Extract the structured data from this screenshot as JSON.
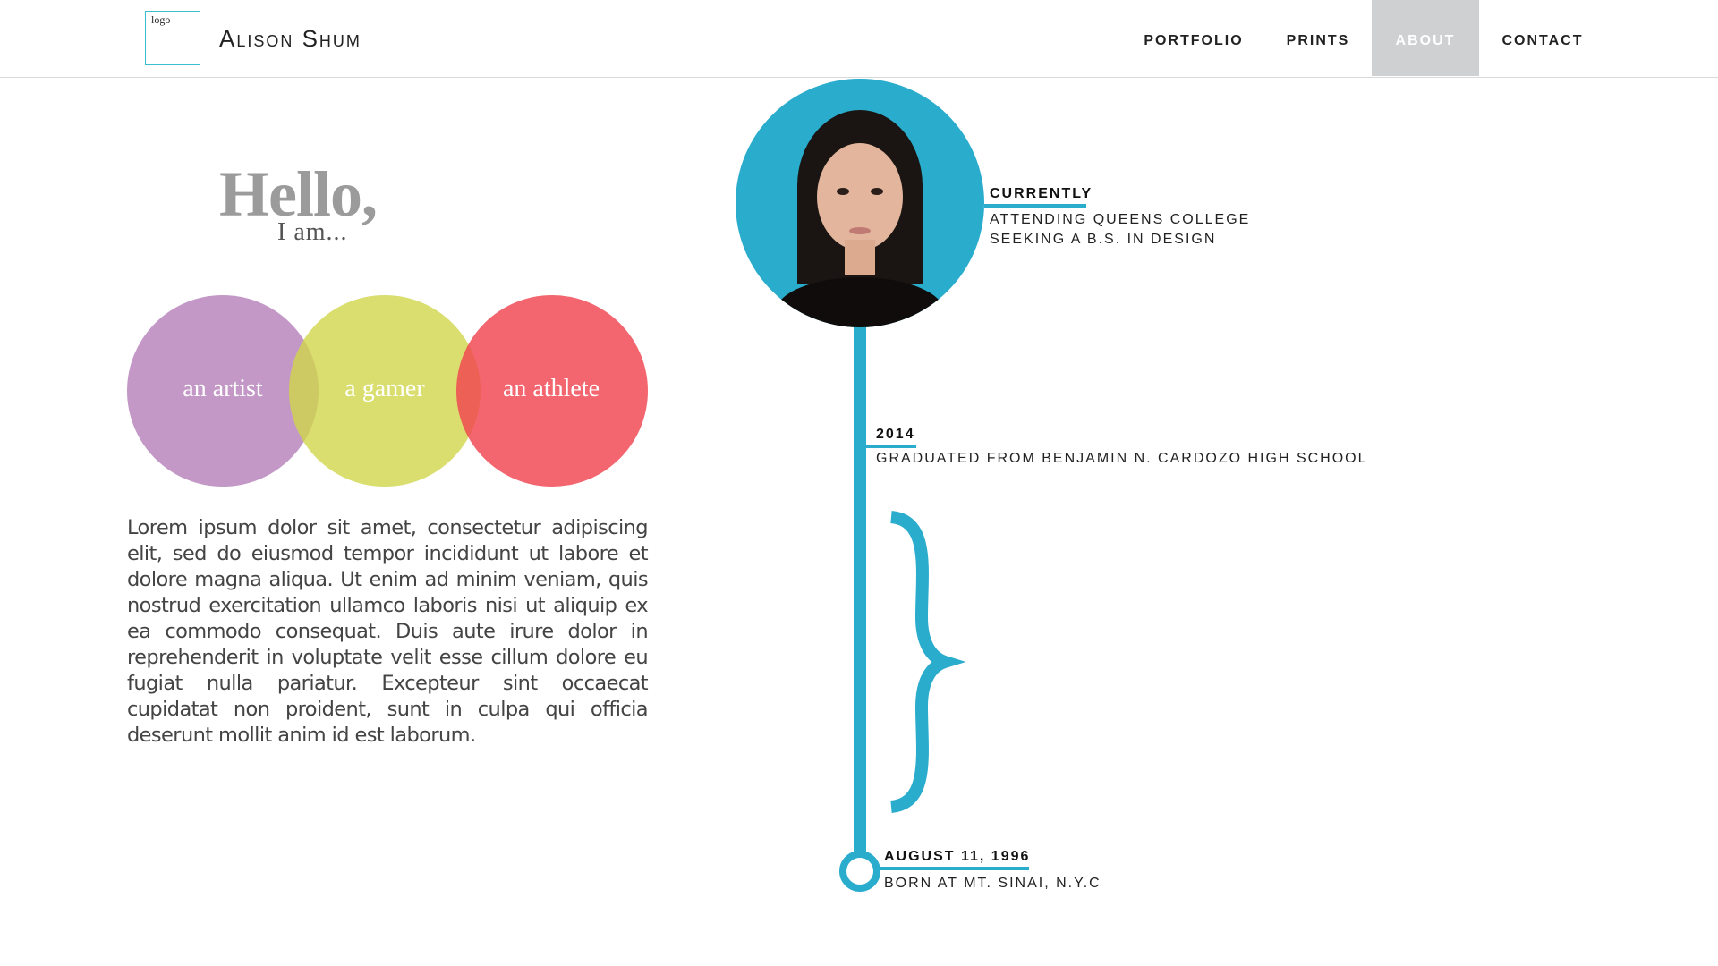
{
  "header": {
    "logo_text": "logo",
    "brand": "Alison Shum",
    "nav": {
      "portfolio": "PORTFOLIO",
      "prints": "PRINTS",
      "about": "ABOUT",
      "contact": "CONTACT"
    }
  },
  "intro": {
    "hello": "Hello,",
    "iam": "I am..."
  },
  "venn": {
    "items": [
      {
        "label": "an artist",
        "color": "#c39ac8"
      },
      {
        "label": "a gamer",
        "color": "#d8de6c"
      },
      {
        "label": "an athlete",
        "color": "#f2646e"
      }
    ]
  },
  "bio": "Lorem ipsum dolor sit amet, consectetur adipiscing elit, sed do eiusmod tempor incididunt ut labore et dolore magna aliqua. Ut enim ad minim veniam, quis nostrud exercitation ullamco laboris nisi ut aliquip ex ea commodo consequat. Duis aute irure dolor in reprehenderit in voluptate velit esse cillum dolore eu fugiat nulla pariatur. Excepteur sint occaecat cupidatat non proident, sunt in culpa qui officia deserunt mollit anim id est laborum.",
  "timeline": {
    "accent": "#2aaccd",
    "current": {
      "title": "CURRENTLY",
      "line1": "ATTENDING QUEENS COLLEGE",
      "line2": "SEEKING A B.S. IN DESIGN"
    },
    "y2014": {
      "title": "2014",
      "text": "GRADUATED FROM BENJAMIN N. CARDOZO HIGH SCHOOL"
    },
    "birth": {
      "title": "AUGUST 11, 1996",
      "text": "BORN AT MT. SINAI, N.Y.C"
    }
  }
}
